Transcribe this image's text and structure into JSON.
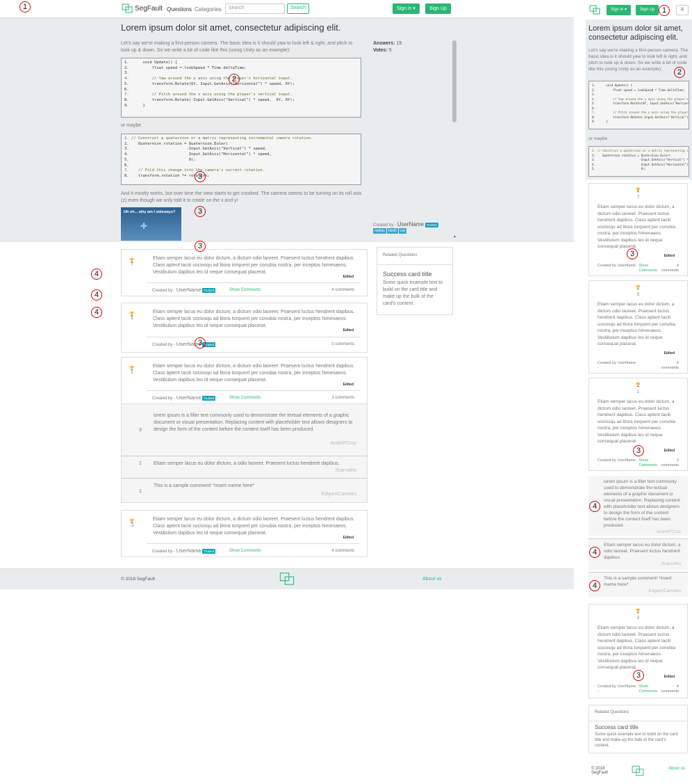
{
  "brand": {
    "name": "SegFault",
    "accent": "#2bb673"
  },
  "nav": {
    "questions": "Questions",
    "categories": "Categories",
    "search_placeholder": "Search",
    "search_button": "Search",
    "sign_in": "Sign in ▾",
    "sign_up": "Sign Up"
  },
  "question": {
    "title": "Lorem ipsum dolor sit amet, consectetur adipiscing elit.",
    "intro": "Let's say we're making a first-person camera. The basic idea is it should yaw to look left & right, and pitch to look up & down. So we write a bit of code like this (using Unity as an example):",
    "or_maybe": "or maybe",
    "outro": "And it mostly works, but over time the view starts to get crooked. The camera seems to be turning on its roll axis (z) even though we only told it to rotate on the x and y!",
    "image_caption": "Uh oh... why am I sideways?",
    "answers_label": "Answers:",
    "answers_value": "15",
    "votes_label": "Votes:",
    "votes_value": "5",
    "created_by": "Created by -",
    "username": "UserName",
    "trusted": "Trusted",
    "tags": [
      "nodejs",
      "html5",
      "css"
    ]
  },
  "code1": [
    "1.      void Update() {",
    "2.          float speed = lookSpeed * Time.deltaTime;",
    "3.",
    "4.          // Yaw around the y axis using the player's horizontal input.",
    "5.          transform.Rotate(0f, Input.GetAxis(\"Horizontal\") * speed, 0f);",
    "6.",
    "7.          // Pitch around the x axis using the player's vertical input.",
    "8.          transform.Rotate(-Input.GetAxis(\"Vertical\") * speed,  0f, 0f);",
    "9.      }"
  ],
  "code2": [
    "1. // Construct a quaternion or a matrix representing incremental camera rotation.",
    "2.    Quaternion rotation = Quaternion.Euler(",
    "3.                         -Input.GetAxis(\"Vertical\") * speed,",
    "4.                          Input.GetAxis(\"Horizontal\") * speed,",
    "5.                          0);",
    "6.",
    "7.    // Fold this change into the camera's current rotation.",
    "8.    transform.rotation *= rotation;"
  ],
  "answers": [
    {
      "votes": "7",
      "text": "Etiam semper lacus eu dolor dictum, a dictum odio laoreet. Praesent luctus hendrerit dapibus. Class aptent taciti sociosqu ad litora torquent per conubia nostra, per inceptos himenaeos. Vestibulum dapibus leo id neque consequat placerat.",
      "edited": "Edited",
      "created_by": "Created by -",
      "username": "UserName",
      "trusted": "Trusted",
      "show_comments": "Show Comments",
      "comments": "4 comments"
    },
    {
      "votes": "5",
      "text": "Etiam semper lacus eu dolor dictum, a dictum odio laoreet. Praesent luctus hendrerit dapibus. Class aptent taciti sociosqu ad litora torquent per conubia nostra, per inceptos himenaeos. Vestibulum dapibus leo id neque consequat placerat.",
      "edited": "Edited",
      "created_by": "Created by -",
      "username": "UserName",
      "trusted": "Trusted",
      "show_comments": "",
      "comments": "0 comments"
    },
    {
      "votes": "1",
      "text": "Etiam semper lacus eu dolor dictum, a dictum odio laoreet. Praesent luctus hendrerit dapibus. Class aptent taciti sociosqu ad litora torquent per conubia nostra, per inceptos himenaeos. Vestibulum dapibus leo id neque consequat placerat.",
      "edited": "Edited",
      "created_by": "Created by -",
      "username": "UserName",
      "trusted": "Trusted",
      "show_comments": "Show Comments",
      "comments": "3 comments"
    },
    {
      "votes": "-2",
      "text": "Etiam semper lacus eu dolor dictum, a dictum odio laoreet. Praesent luctus hendrerit dapibus. Class aptent taciti sociosqu ad litora torquent per conubia nostra, per inceptos himenaeos. Vestibulum dapibus leo id neque consequat placerat.",
      "edited": "Edited",
      "created_by": "Created by -",
      "username": "UserName",
      "trusted": "Trusted",
      "show_comments": "Show Comments",
      "comments": "4 comments"
    }
  ],
  "comments": [
    {
      "votes": "3",
      "text": "lorem ipsum is a filler text commonly used to demonstrate the textual elements of a graphic document or visual presentation. Replacing content with placeholder text allows designers to design the form of the content before the content itself has been produced.",
      "author": "AndréFCruz"
    },
    {
      "votes": "1",
      "text": "Etiam semper lacus eu dolor dictum, a odio laoreet. Praesent luctus hendrerit dapibus.",
      "author": "jfcarvalho"
    },
    {
      "votes": "1",
      "text": "This is a sample comment! *insert meme here*",
      "author": "EdgarACarneiro"
    }
  ],
  "related": {
    "header": "Related Questions",
    "card_title": "Success card title",
    "card_text": "Some quick example text to build on the card title and make up the bulk of the card's content."
  },
  "footer": {
    "copyright": "© 2018 SegFault",
    "about": "About us"
  },
  "mobile": {
    "answers": [
      {
        "votes": "7",
        "text": "Etiam semper lacus eu dolor dictum, a dictum odio laoreet. Praesent luctus hendrerit dapibus. Class aptent taciti sociosqu ad litora torquent per conubia nostra, per inceptos himenaeos. Vestibulum dapibus leo id neque consequat placerat.",
        "comments": "4 comments"
      },
      {
        "votes": "5",
        "text": "Etiam semper lacus eu dolor dictum, a dictum odio laoreet. Praesent luctus hendrerit dapibus. Class aptent taciti sociosqu ad litora torquent per conubia nostra, per inceptos himenaeos. Vestibulum dapibus leo id neque consequat placerat.",
        "comments": "0 comments"
      },
      {
        "votes": "1",
        "text": "Etiam semper lacus eu dolor dictum, a dictum odio laoreet. Praesent luctus hendrerit dapibus. Class aptent taciti sociosqu ad litora torquent per conubia nostra, per inceptos himenaeos. Vestibulum dapibus leo id neque consequat placerat.",
        "comments": "3 comments"
      },
      {
        "votes": "2",
        "text": "Etiam semper lacus eu dolor dictum, a dictum odio laoreet. Praesent luctus hendrerit dapibus. Class aptent taciti sociosqu ad litora torquent per conubia nostra, per inceptos himenaeos. Vestibulum dapibus leo id neque consequat placerat.",
        "comments": "4 comments"
      }
    ],
    "created_by": "Created by -",
    "footer_copyright": "© 2018 SegFault"
  },
  "markers": [
    "1",
    "2",
    "3",
    "4"
  ]
}
